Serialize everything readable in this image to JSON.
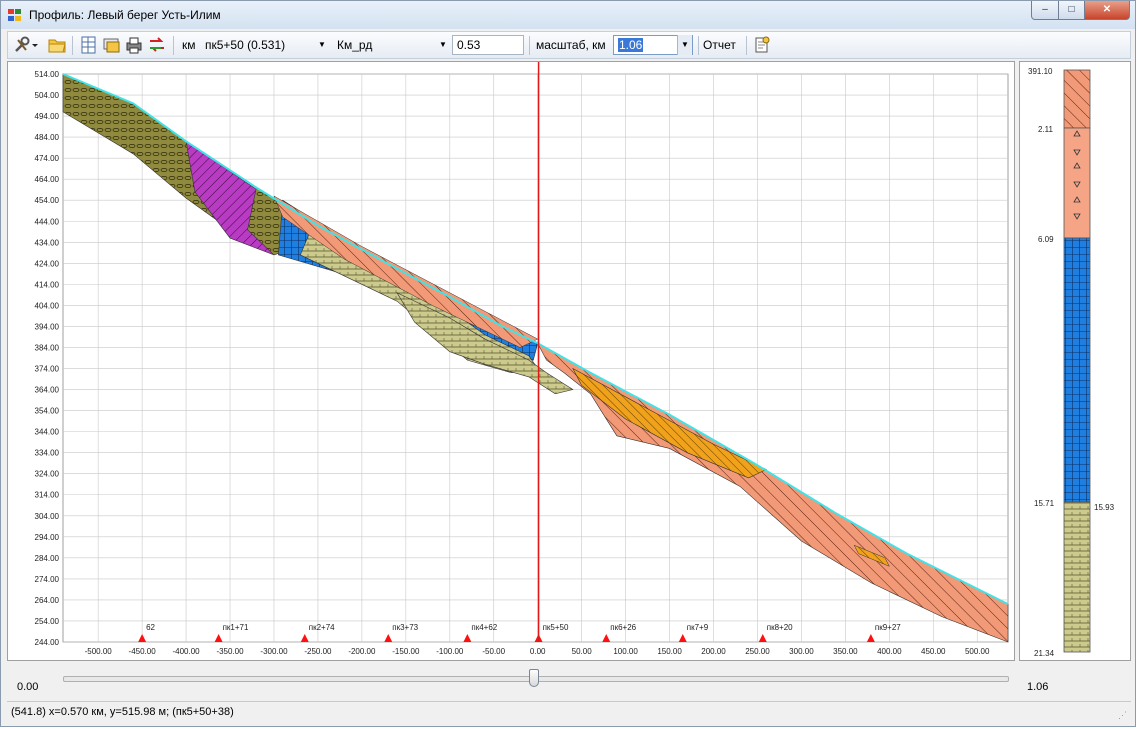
{
  "window": {
    "title": "Профиль: Левый берег Усть-Илим",
    "btn_min": "–",
    "btn_max": "□",
    "btn_close": "✕"
  },
  "toolbar": {
    "unit_label": "км",
    "picket_value": "пк5+50 (0.531)",
    "column_value": "Км_рд",
    "km_value": "0.53",
    "scale_label": "масштаб, км",
    "scale_value": "1.06",
    "report_label": "Отчет",
    "icons": [
      "tools-menu-icon",
      "open-folder-icon",
      "table-icon",
      "layers-icon",
      "print-icon",
      "settings-icon",
      "swap-icon",
      "report-icon"
    ]
  },
  "chart": {
    "y_ticks": [
      "514.00",
      "504.00",
      "494.00",
      "484.00",
      "474.00",
      "464.00",
      "454.00",
      "444.00",
      "434.00",
      "424.00",
      "414.00",
      "404.00",
      "394.00",
      "384.00",
      "374.00",
      "364.00",
      "354.00",
      "344.00",
      "334.00",
      "324.00",
      "314.00",
      "304.00",
      "294.00",
      "284.00",
      "274.00",
      "264.00",
      "254.00",
      "244.00"
    ],
    "x_ticks": [
      "-500.00",
      "-450.00",
      "-400.00",
      "-350.00",
      "-300.00",
      "-250.00",
      "-200.00",
      "-150.00",
      "-100.00",
      "-50.00",
      "0.00",
      "50.00",
      "100.00",
      "150.00",
      "200.00",
      "250.00",
      "300.00",
      "350.00",
      "400.00",
      "450.00",
      "500.00"
    ],
    "pickets": [
      {
        "label": "62",
        "x": -450
      },
      {
        "label": "пк1+71",
        "x": -363
      },
      {
        "label": "пк2+74",
        "x": -265
      },
      {
        "label": "пк3+73",
        "x": -170
      },
      {
        "label": "пк4+62",
        "x": -80
      },
      {
        "label": "пк5+50",
        "x": 1
      },
      {
        "label": "пк6+26",
        "x": 78
      },
      {
        "label": "пк7+9",
        "x": 165
      },
      {
        "label": "пк8+20",
        "x": 256
      },
      {
        "label": "пк9+27",
        "x": 379
      }
    ],
    "cursor_x": 1,
    "colors": {
      "olive": "#8f8a3e",
      "magenta": "#b93bc4",
      "blue": "#1f7fe0",
      "khaki": "#cdca8e",
      "salmon": "#f29a77",
      "orange": "#f0a21c",
      "surface": "#3fe3e8",
      "cursor": "#e01818",
      "picket": "#ff1010"
    }
  },
  "column": {
    "labels": {
      "top": "391.10",
      "l1": "2.11",
      "l2": "6.09",
      "l3": "15.71",
      "l3r": "15.93",
      "bottom": "21.34"
    }
  },
  "slider": {
    "min_label": "0.00",
    "max_label": "1.06",
    "position": 0.5
  },
  "status": {
    "text": "(541.8) x=0.570 км, y=515.98 м; (пк5+50+38)"
  }
}
